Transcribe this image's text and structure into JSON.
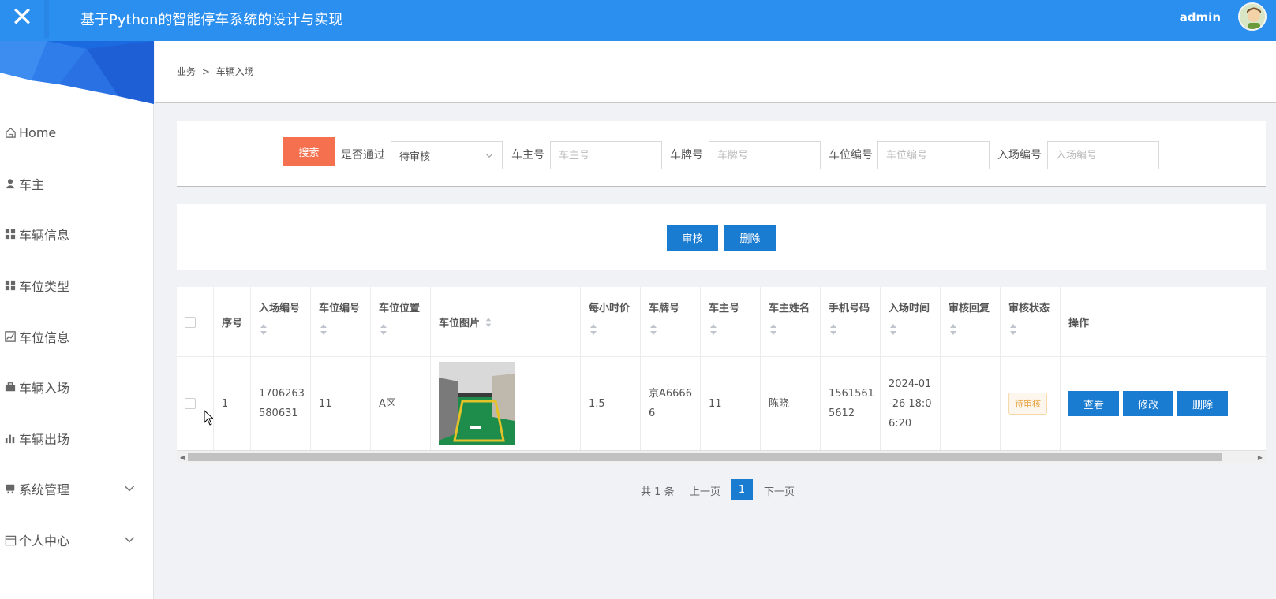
{
  "topbar": {
    "close_glyph": "✕",
    "title": "基于Python的智能停车系统的设计与实现",
    "username": "admin"
  },
  "sidebar": {
    "items": [
      {
        "label": "Home",
        "icon": "home-icon"
      },
      {
        "label": "车主",
        "icon": "user-icon"
      },
      {
        "label": "车辆信息",
        "icon": "grid-icon"
      },
      {
        "label": "车位类型",
        "icon": "grid-icon"
      },
      {
        "label": "车位信息",
        "icon": "chart-area-icon"
      },
      {
        "label": "车辆入场",
        "icon": "briefcase-icon"
      },
      {
        "label": "车辆出场",
        "icon": "bar-chart-icon"
      },
      {
        "label": "系统管理",
        "icon": "server-icon"
      },
      {
        "label": "个人中心",
        "icon": "calendar-icon"
      }
    ]
  },
  "breadcrumb": {
    "parent": "业务",
    "separator": ">",
    "current": "车辆入场"
  },
  "search": {
    "button_label": "搜索",
    "approved_label": "是否通过",
    "approved_value": "待审核",
    "owner_no_label": "车主号",
    "owner_no_placeholder": "车主号",
    "plate_label": "车牌号",
    "plate_placeholder": "车牌号",
    "space_no_label": "车位编号",
    "space_no_placeholder": "车位编号",
    "entry_no_label": "入场编号",
    "entry_no_placeholder": "入场编号"
  },
  "actions": {
    "review_label": "审核",
    "delete_label": "删除"
  },
  "table": {
    "columns": [
      "序号",
      "入场编号",
      "车位编号",
      "车位位置",
      "车位图片",
      "每小时价",
      "车牌号",
      "车主号",
      "车主姓名",
      "手机号码",
      "入场时间",
      "审核回复",
      "审核状态",
      "操作"
    ],
    "rows": [
      {
        "index": "1",
        "entry_no_a": "1706263",
        "entry_no_b": "580631",
        "space_no": "11",
        "location": "A区",
        "price": "1.5",
        "plate_a": "京A6666",
        "plate_b": "6",
        "owner_no": "11",
        "owner_name": "陈晓",
        "phone_a": "1561561",
        "phone_b": "5612",
        "time_a": "2024-01",
        "time_b": "-26 18:0",
        "time_c": "6:20",
        "reply": "",
        "status": "待审核",
        "view_label": "查看",
        "edit_label": "修改",
        "delete_label": "删除"
      }
    ]
  },
  "pager": {
    "total": "共 1 条",
    "prev": "上一页",
    "current": "1",
    "next": "下一页"
  },
  "colors": {
    "topbar": "#2b8ff0",
    "search_button": "#f5704f",
    "primary_button": "#1a7cd0",
    "status_badge_text": "#e6a23c"
  }
}
